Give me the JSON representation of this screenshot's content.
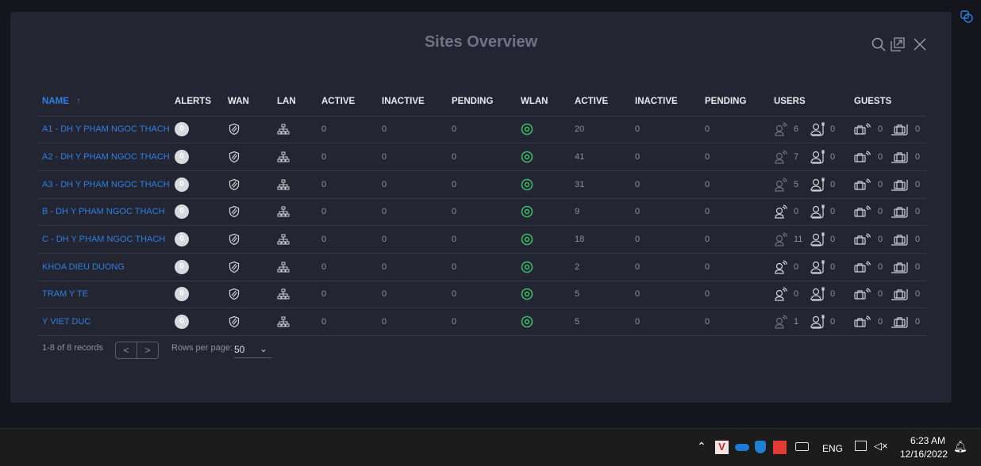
{
  "modal": {
    "title": "Sites Overview"
  },
  "columns": [
    "NAME",
    "ALERTS",
    "WAN",
    "LAN",
    "ACTIVE",
    "INACTIVE",
    "PENDING",
    "WLAN",
    "ACTIVE",
    "INACTIVE",
    "PENDING",
    "USERS",
    "GUESTS"
  ],
  "sort_indicator": "↑",
  "rows": [
    {
      "name": "A1 - DH Y PHAM NGOC THACH",
      "alerts": "0",
      "lan_active": "0",
      "lan_inactive": "0",
      "lan_pending": "0",
      "wlan_active": "20",
      "wlan_inactive": "0",
      "wlan_pending": "0",
      "users_wireless": "6",
      "users_wired": "0",
      "guests_wireless": "0",
      "guests_wired": "0"
    },
    {
      "name": "A2 - DH Y PHAM NGOC THACH",
      "alerts": "0",
      "lan_active": "0",
      "lan_inactive": "0",
      "lan_pending": "0",
      "wlan_active": "41",
      "wlan_inactive": "0",
      "wlan_pending": "0",
      "users_wireless": "7",
      "users_wired": "0",
      "guests_wireless": "0",
      "guests_wired": "0"
    },
    {
      "name": "A3 - DH Y PHAM NGOC THACH",
      "alerts": "0",
      "lan_active": "0",
      "lan_inactive": "0",
      "lan_pending": "0",
      "wlan_active": "31",
      "wlan_inactive": "0",
      "wlan_pending": "0",
      "users_wireless": "5",
      "users_wired": "0",
      "guests_wireless": "0",
      "guests_wired": "0"
    },
    {
      "name": "B - DH Y PHAM NGOC THACH",
      "alerts": "0",
      "lan_active": "0",
      "lan_inactive": "0",
      "lan_pending": "0",
      "wlan_active": "9",
      "wlan_inactive": "0",
      "wlan_pending": "0",
      "users_wireless": "0",
      "users_wired": "0",
      "guests_wireless": "0",
      "guests_wired": "0"
    },
    {
      "name": "C - DH Y PHAM NGOC THACH",
      "alerts": "0",
      "lan_active": "0",
      "lan_inactive": "0",
      "lan_pending": "0",
      "wlan_active": "18",
      "wlan_inactive": "0",
      "wlan_pending": "0",
      "users_wireless": "11",
      "users_wired": "0",
      "guests_wireless": "0",
      "guests_wired": "0"
    },
    {
      "name": "KHOA DIEU DUONG",
      "alerts": "0",
      "lan_active": "0",
      "lan_inactive": "0",
      "lan_pending": "0",
      "wlan_active": "2",
      "wlan_inactive": "0",
      "wlan_pending": "0",
      "users_wireless": "0",
      "users_wired": "0",
      "guests_wireless": "0",
      "guests_wired": "0"
    },
    {
      "name": "TRAM Y TE",
      "alerts": "0",
      "lan_active": "0",
      "lan_inactive": "0",
      "lan_pending": "0",
      "wlan_active": "5",
      "wlan_inactive": "0",
      "wlan_pending": "0",
      "users_wireless": "0",
      "users_wired": "0",
      "guests_wireless": "0",
      "guests_wired": "0"
    },
    {
      "name": "Y VIET DUC",
      "alerts": "0",
      "lan_active": "0",
      "lan_inactive": "0",
      "lan_pending": "0",
      "wlan_active": "5",
      "wlan_inactive": "0",
      "wlan_pending": "0",
      "users_wireless": "1",
      "users_wired": "0",
      "guests_wireless": "0",
      "guests_wired": "0"
    }
  ],
  "footer": {
    "records": "1-8 of 8 records",
    "prev": "<",
    "next": ">",
    "rows_per_page_label": "Rows per page:",
    "rows_per_page": "50"
  },
  "taskbar": {
    "language": "ENG",
    "time": "6:23 AM",
    "date": "12/16/2022"
  },
  "colors": {
    "accent": "#2f7fe0",
    "wlan_ok": "#3fbf6a"
  }
}
